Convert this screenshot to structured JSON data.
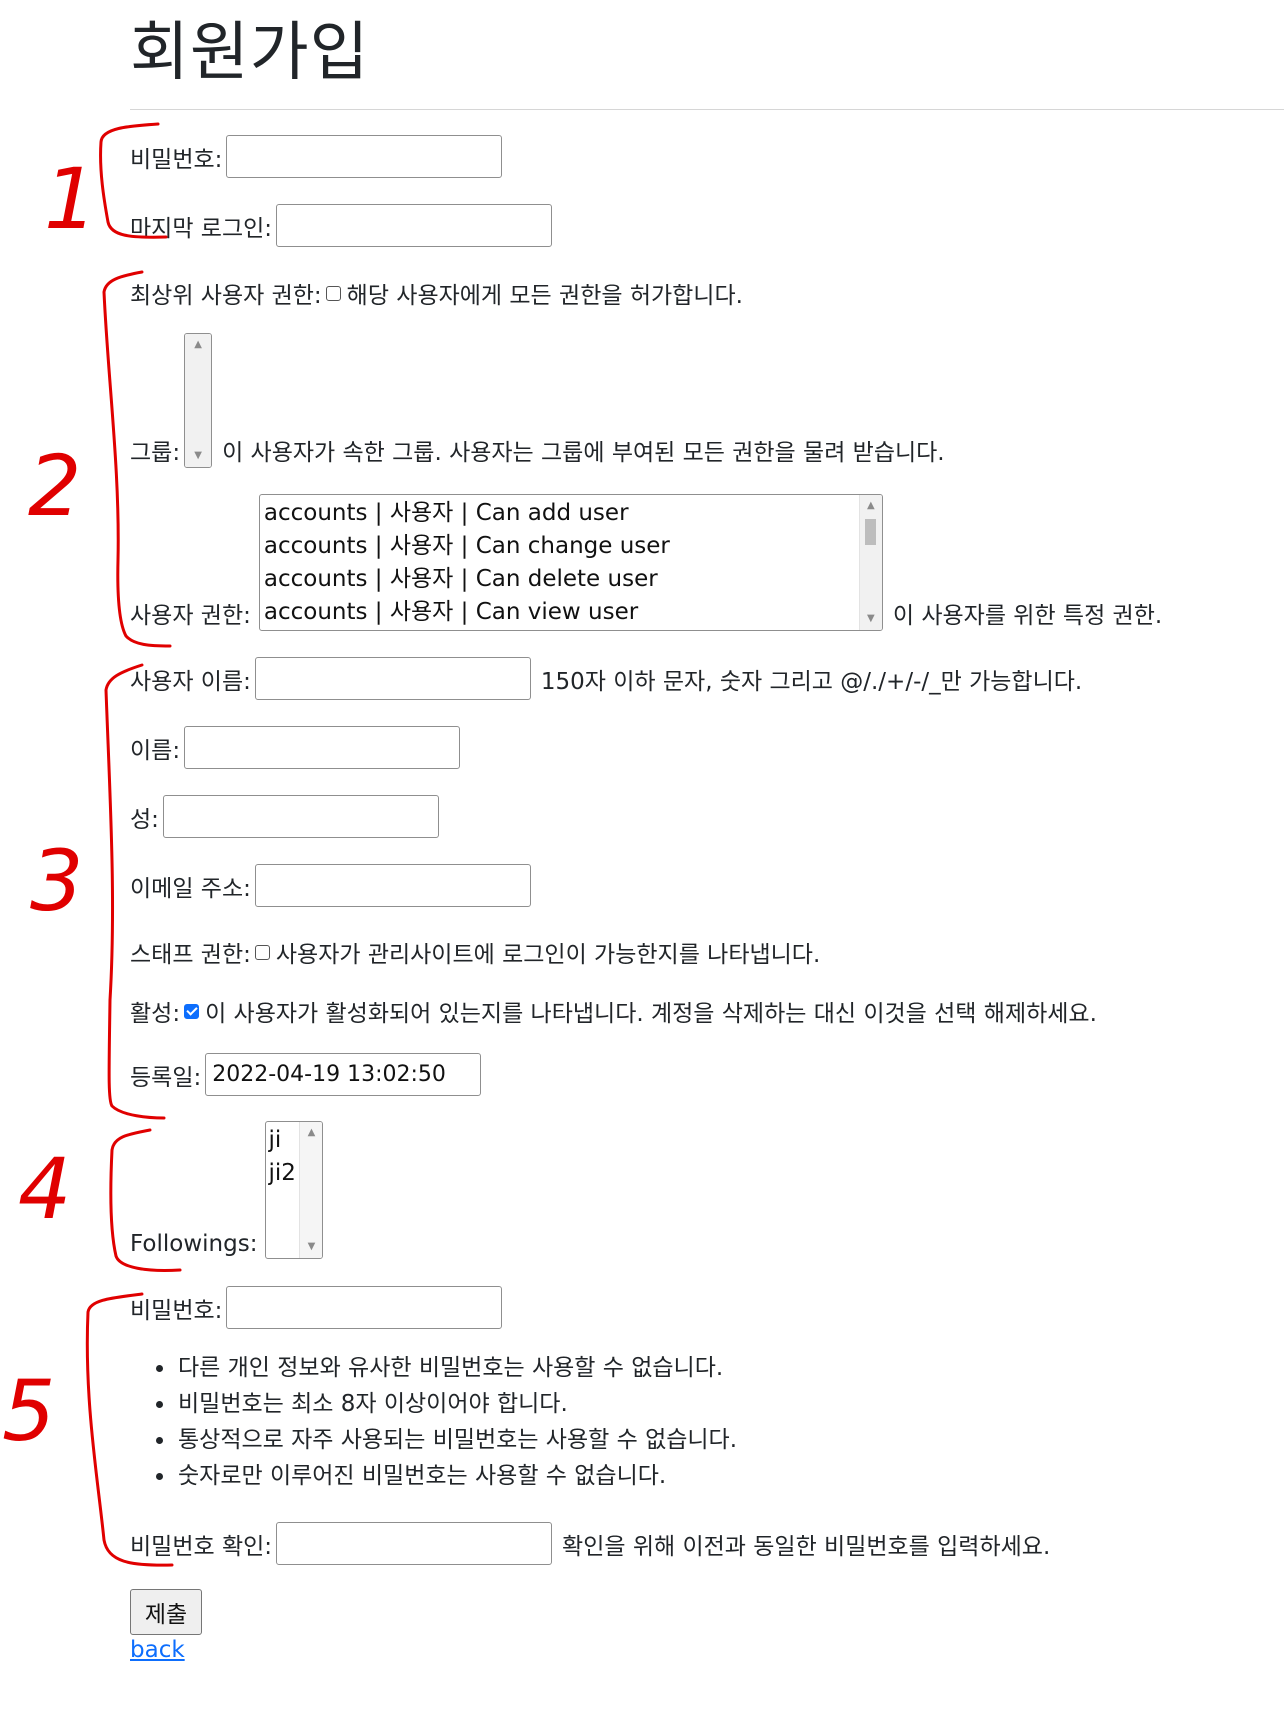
{
  "page": {
    "title": "회원가입"
  },
  "section1": {
    "password_label": "비밀번호:",
    "password_value": "",
    "last_login_label": "마지막 로그인:",
    "last_login_value": ""
  },
  "section2": {
    "superuser_label": "최상위 사용자 권한:",
    "superuser_checked": false,
    "superuser_help": "해당 사용자에게 모든 권한을 허가합니다.",
    "groups_label": "그룹:",
    "groups_options": [],
    "groups_help": "이 사용자가 속한 그룹. 사용자는 그룹에 부여된 모든 권한을 물려 받습니다.",
    "permissions_label": "사용자 권한:",
    "permissions_options": [
      "accounts | 사용자 | Can add user",
      "accounts | 사용자 | Can change user",
      "accounts | 사용자 | Can delete user",
      "accounts | 사용자 | Can view user"
    ],
    "permissions_help": "이 사용자를 위한 특정 권한."
  },
  "section3": {
    "username_label": "사용자 이름:",
    "username_value": "",
    "username_help": "150자 이하 문자, 숫자 그리고 @/./+/-/_만 가능합니다.",
    "first_name_label": "이름:",
    "first_name_value": "",
    "last_name_label": "성:",
    "last_name_value": "",
    "email_label": "이메일 주소:",
    "email_value": "",
    "staff_label": "스태프 권한:",
    "staff_checked": false,
    "staff_help": "사용자가 관리사이트에 로그인이 가능한지를 나타냅니다.",
    "active_label": "활성:",
    "active_checked": true,
    "active_help": "이 사용자가 활성화되어 있는지를 나타냅니다. 계정을 삭제하는 대신 이것을 선택 해제하세요.",
    "date_joined_label": "등록일:",
    "date_joined_value": "2022-04-19 13:02:50"
  },
  "section4": {
    "followings_label": "Followings:",
    "followings_options": [
      "ji",
      "ji2"
    ]
  },
  "section5": {
    "password1_label": "비밀번호:",
    "password1_value": "",
    "rules": [
      "다른 개인 정보와 유사한 비밀번호는 사용할 수 없습니다.",
      "비밀번호는 최소 8자 이상이어야 합니다.",
      "통상적으로 자주 사용되는 비밀번호는 사용할 수 없습니다.",
      "숫자로만 이루어진 비밀번호는 사용할 수 없습니다."
    ],
    "password2_label": "비밀번호 확인:",
    "password2_value": "",
    "password2_help": "확인을 위해 이전과 동일한 비밀번호를 입력하세요."
  },
  "actions": {
    "submit_label": "제출",
    "back_label": "back"
  },
  "annotations": {
    "color": "#e00000",
    "numbers": [
      "1",
      "2",
      "3",
      "4",
      "5"
    ]
  }
}
